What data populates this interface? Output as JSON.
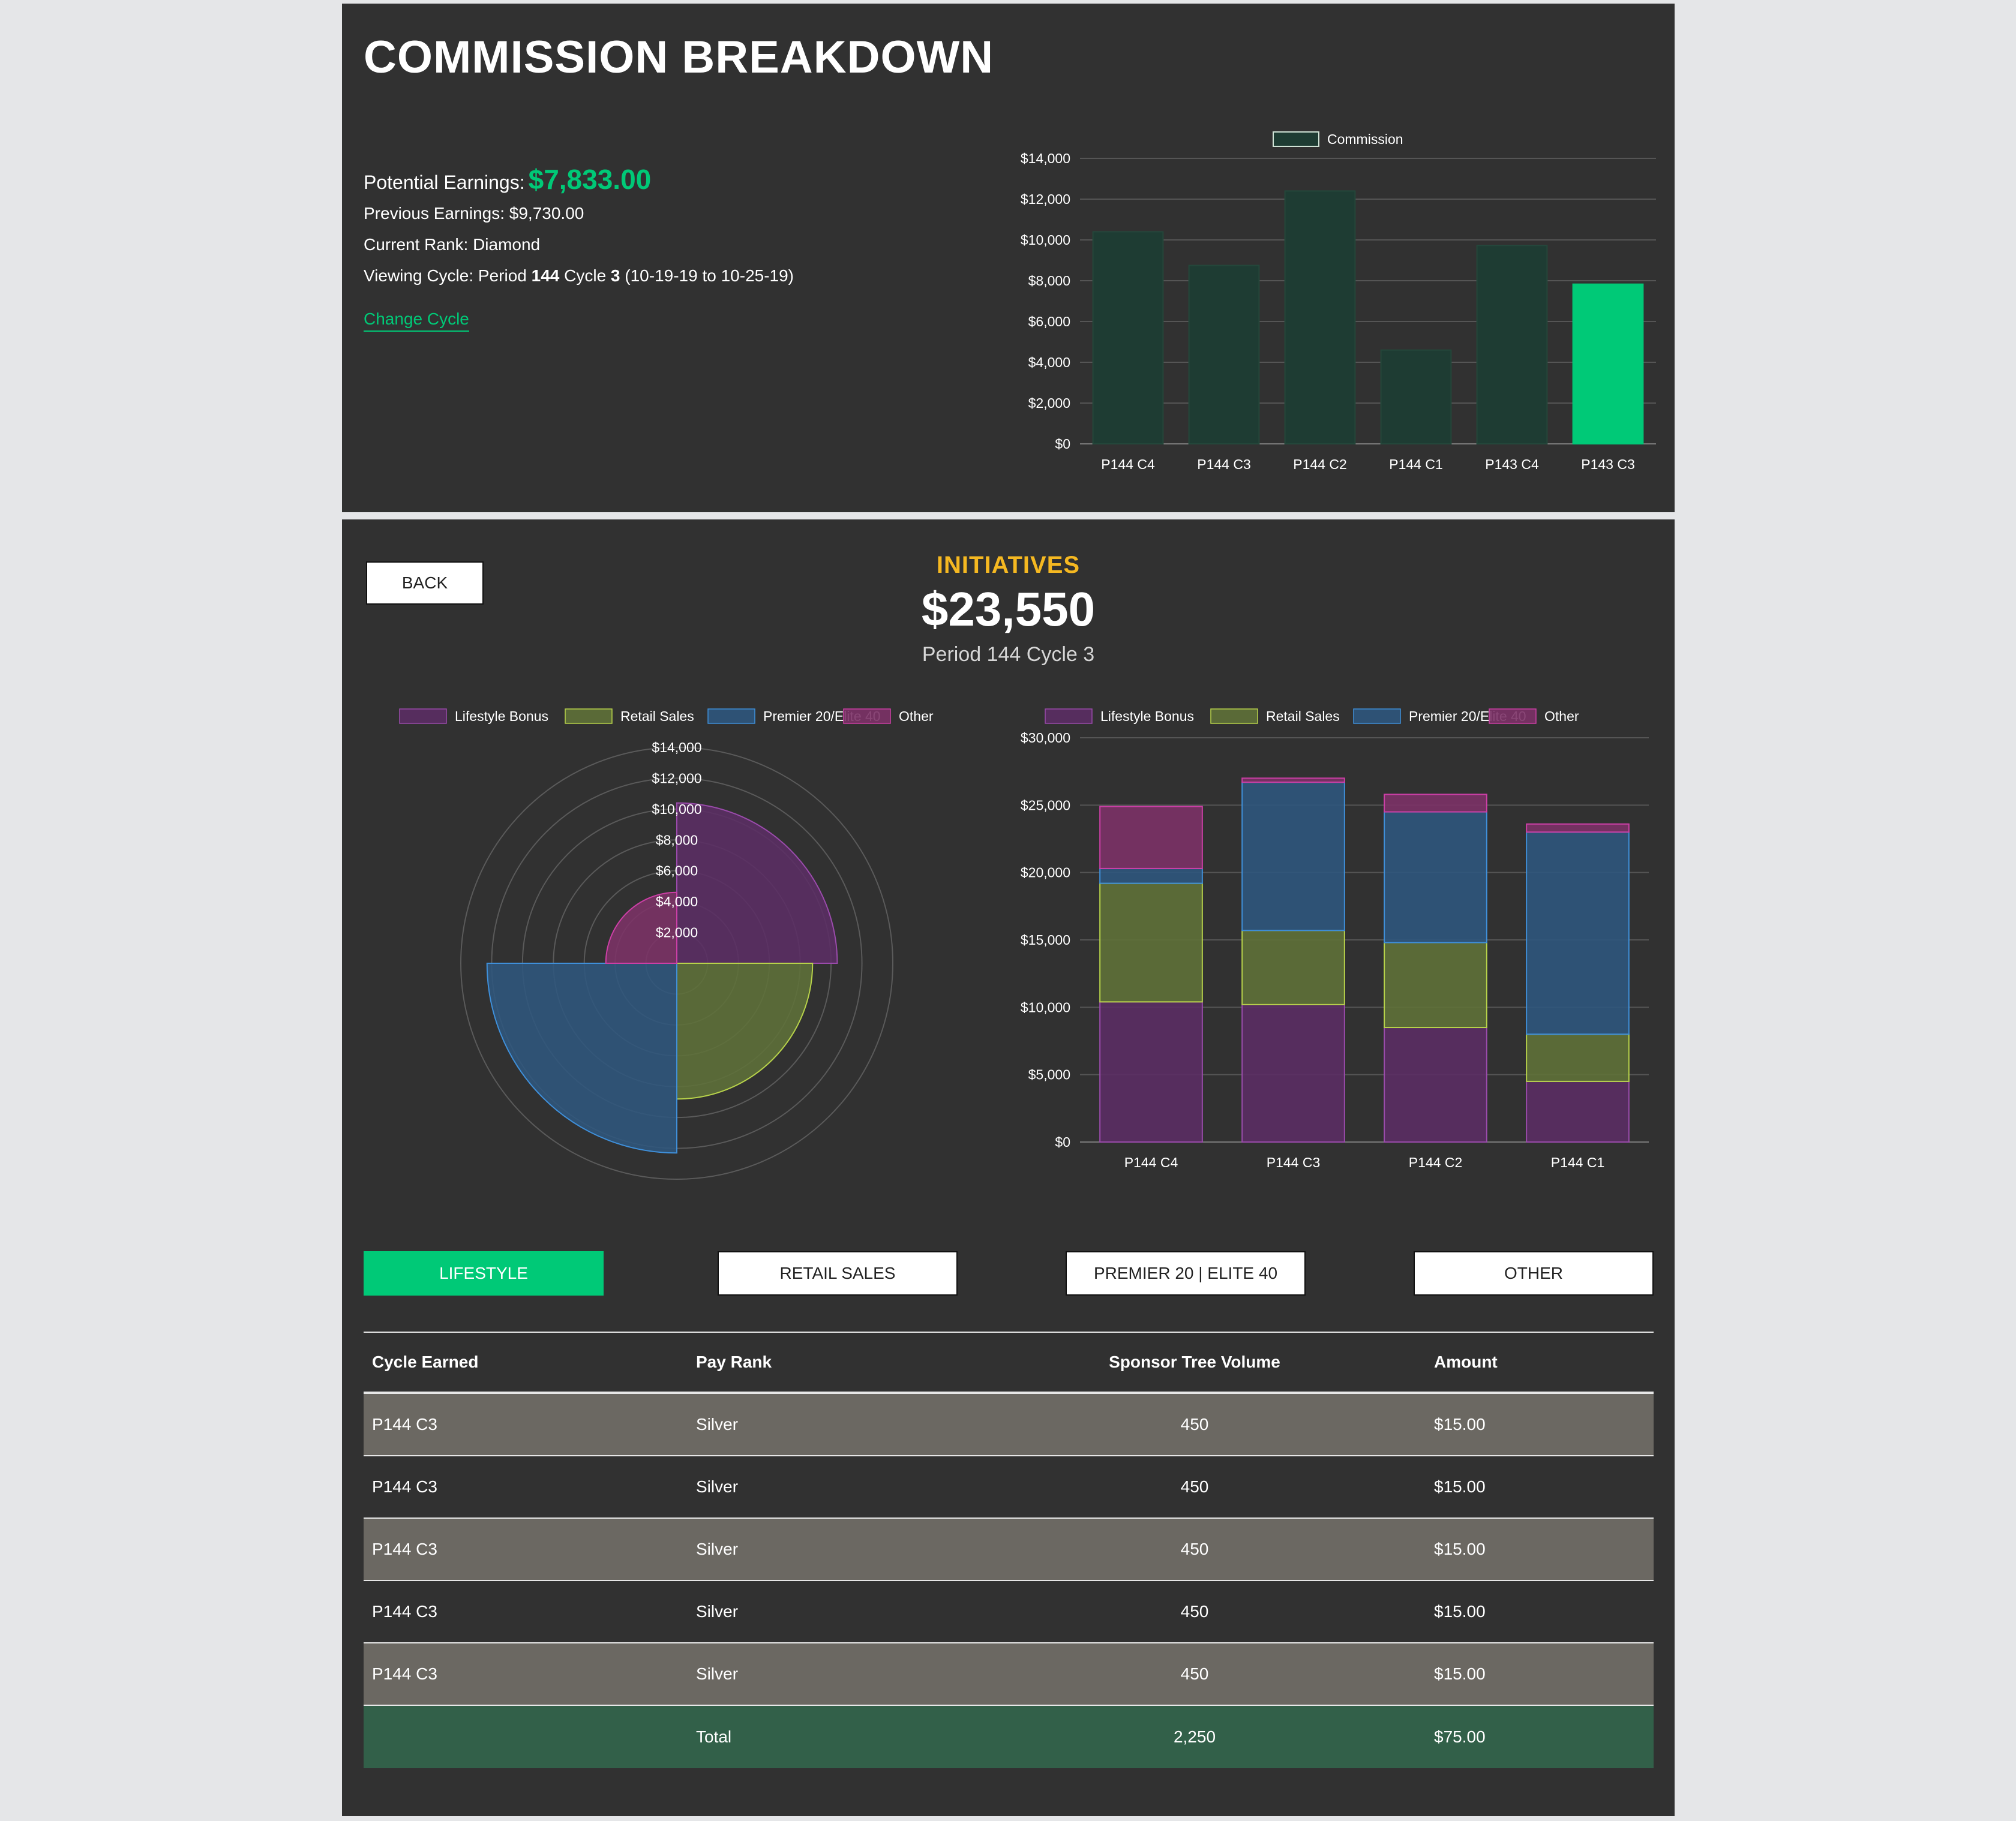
{
  "header": {
    "title": "COMMISSION BREAKDOWN",
    "potential_label": "Potential Earnings:",
    "potential_value": "$7,833.00",
    "previous": "Previous Earnings: $9,730.00",
    "rank": "Current Rank: Diamond",
    "cycle_prefix": "Viewing Cycle: Period ",
    "cycle_period": "144",
    "cycle_mid": " Cycle ",
    "cycle_cycle": "3",
    "cycle_suffix": " (10-19-19 to 10-25-19)",
    "change_cycle": "Change Cycle"
  },
  "initiatives": {
    "back_label": "BACK",
    "title": "INITIATIVES",
    "total": "$23,550",
    "period": "Period 144 Cycle 3"
  },
  "tabs": [
    {
      "label": "LIFESTYLE",
      "active": true
    },
    {
      "label": "RETAIL SALES",
      "active": false
    },
    {
      "label": "PREMIER 20 | ELITE 40",
      "active": false
    },
    {
      "label": "OTHER",
      "active": false
    }
  ],
  "table": {
    "headers": [
      "Cycle Earned",
      "Pay Rank",
      "Sponsor Tree Volume",
      "Amount"
    ],
    "rows": [
      [
        "P144 C3",
        "Silver",
        "450",
        "$15.00"
      ],
      [
        "P144 C3",
        "Silver",
        "450",
        "$15.00"
      ],
      [
        "P144 C3",
        "Silver",
        "450",
        "$15.00"
      ],
      [
        "P144 C3",
        "Silver",
        "450",
        "$15.00"
      ],
      [
        "P144 C3",
        "Silver",
        "450",
        "$15.00"
      ]
    ],
    "total": {
      "label": "Total",
      "volume": "2,250",
      "amount": "$75.00"
    }
  },
  "colors": {
    "accent": "#00c977",
    "gold": "#f5b821",
    "bar_dim": "#1e3c33",
    "lifestyle": "#5b2e64",
    "retail": "#5f7139",
    "premier": "#2f577d",
    "other": "#7c3267"
  },
  "chart_data": [
    {
      "type": "bar",
      "legend": [
        "Commission"
      ],
      "categories": [
        "P144 C4",
        "P144 C3",
        "P144 C2",
        "P144 C1",
        "P143 C4",
        "P143 C3"
      ],
      "values": [
        10400,
        8750,
        12400,
        4600,
        9730,
        7833
      ],
      "highlight_index": 5,
      "ylim": [
        0,
        14000
      ],
      "yticks": [
        "$0",
        "$2,000",
        "$4,000",
        "$6,000",
        "$8,000",
        "$10,000",
        "$12,000",
        "$14,000"
      ],
      "grid": true
    },
    {
      "type": "polar-area",
      "legend": [
        "Lifestyle Bonus",
        "Retail Sales",
        "Premier 20/Elite 40",
        "Other"
      ],
      "values": [
        10400,
        8800,
        12300,
        4600
      ],
      "rlim": [
        0,
        14000
      ],
      "rticks": [
        "$2,000",
        "$4,000",
        "$6,000",
        "$8,000",
        "$10,000",
        "$12,000",
        "$14,000"
      ]
    },
    {
      "type": "bar",
      "stacked": true,
      "categories": [
        "P144 C4",
        "P144 C3",
        "P144 C2",
        "P144 C1"
      ],
      "series": [
        {
          "name": "Lifestyle Bonus",
          "values": [
            10400,
            10200,
            8500,
            4500
          ]
        },
        {
          "name": "Retail Sales",
          "values": [
            8800,
            5500,
            6300,
            3500
          ]
        },
        {
          "name": "Premier 20/Elite 40",
          "values": [
            1100,
            11000,
            9700,
            15000
          ]
        },
        {
          "name": "Other",
          "values": [
            4600,
            300,
            1300,
            600
          ]
        }
      ],
      "ylim": [
        0,
        30000
      ],
      "yticks": [
        "$0",
        "$5,000",
        "$10,000",
        "$15,000",
        "$20,000",
        "$25,000",
        "$30,000"
      ],
      "grid": true
    }
  ]
}
